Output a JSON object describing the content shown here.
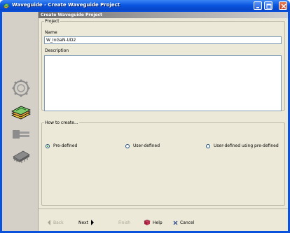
{
  "window": {
    "title": "Waveguide - Create Waveguide Project",
    "title_color": "#0a52db"
  },
  "header": {
    "title": "Create Waveguide Project"
  },
  "project_group": {
    "legend": "Project",
    "name_label": "Name",
    "name_value": "W_InGaN-UD2",
    "description_label": "Description",
    "description_value": ""
  },
  "how_group": {
    "legend": "How to create...",
    "options": [
      {
        "label": "Pre-defined",
        "selected": true
      },
      {
        "label": "User-defined",
        "selected": false
      },
      {
        "label": "User-defined using pre-defined",
        "selected": false
      }
    ]
  },
  "sidebar": {
    "icons": [
      "circuit-ring-icon",
      "layered-slab-icon",
      "fiber-connector-icon",
      "chip-package-icon"
    ],
    "active_index": 1
  },
  "buttons": {
    "back": "Back",
    "next": "Next",
    "finish": "Finish",
    "help": "Help",
    "cancel": "Cancel"
  }
}
